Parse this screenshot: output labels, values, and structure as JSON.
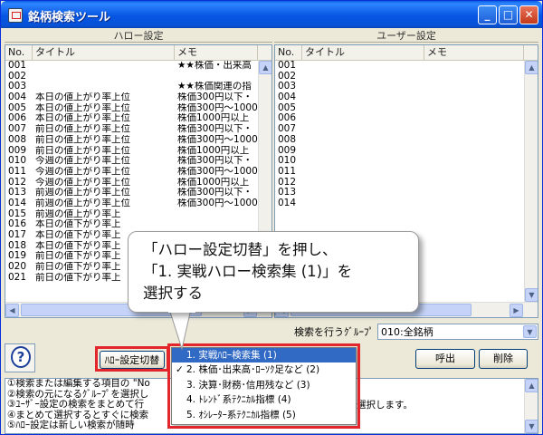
{
  "window": {
    "title": "銘柄検索ツール"
  },
  "left_panel": {
    "heading": "ハロー設定",
    "columns": [
      "No.",
      "タイトル",
      "メモ"
    ],
    "rows": [
      {
        "no": "001",
        "title": "",
        "memo": "★★株価・出来高"
      },
      {
        "no": "002",
        "title": "",
        "memo": ""
      },
      {
        "no": "003",
        "title": "",
        "memo": "★★株価関連の指"
      },
      {
        "no": "004",
        "title": "本日の値上がり率上位",
        "memo": "株価300円以下・"
      },
      {
        "no": "005",
        "title": "本日の値上がり率上位",
        "memo": "株価300円～1000"
      },
      {
        "no": "006",
        "title": "本日の値上がり率上位",
        "memo": "株価1000円以上"
      },
      {
        "no": "007",
        "title": "前日の値上がり率上位",
        "memo": "株価300円以下・"
      },
      {
        "no": "008",
        "title": "前日の値上がり率上位",
        "memo": "株価300円～1000"
      },
      {
        "no": "009",
        "title": "前日の値上がり率上位",
        "memo": "株価1000円以上"
      },
      {
        "no": "010",
        "title": "今週の値上がり率上位",
        "memo": "株価300円以下・"
      },
      {
        "no": "011",
        "title": "今週の値上がり率上位",
        "memo": "株価300円～1000"
      },
      {
        "no": "012",
        "title": "今週の値上がり率上位",
        "memo": "株価1000円以上"
      },
      {
        "no": "013",
        "title": "前週の値上がり率上位",
        "memo": "株価300円以下・"
      },
      {
        "no": "014",
        "title": "前週の値上がり率上位",
        "memo": "株価300円～1000"
      },
      {
        "no": "015",
        "title": "前週の値上がり率上",
        "memo": ""
      },
      {
        "no": "016",
        "title": "本日の値下がり率上",
        "memo": ""
      },
      {
        "no": "017",
        "title": "本日の値下がり率上",
        "memo": ""
      },
      {
        "no": "018",
        "title": "本日の値下がり率上",
        "memo": ""
      },
      {
        "no": "019",
        "title": "前日の値下がり率上",
        "memo": ""
      },
      {
        "no": "020",
        "title": "前日の値下がり率上",
        "memo": ""
      },
      {
        "no": "021",
        "title": "前日の値下がり率上",
        "memo": ""
      }
    ]
  },
  "right_panel": {
    "heading": "ユーザー設定",
    "columns": [
      "No.",
      "タイトル",
      "メモ"
    ],
    "rows": [
      "001",
      "002",
      "003",
      "004",
      "005",
      "006",
      "007",
      "008",
      "009",
      "010",
      "011",
      "012",
      "013",
      "014"
    ]
  },
  "group_select": {
    "label": "検索を行うｸﾞﾙｰﾌﾟ",
    "value": "010:全銘柄"
  },
  "buttons": {
    "switch": "ﾊﾛｰ設定切替",
    "call": "呼出",
    "delete": "削除",
    "help": "?"
  },
  "menu": {
    "items": [
      {
        "label": "1. 実戦ﾊﾛｰ検索集 (1)",
        "checked": false,
        "selected": true
      },
      {
        "label": "2. 株価･出来高･ﾛｰｿｸ足など (2)",
        "checked": true,
        "selected": false
      },
      {
        "label": "3. 決算･財務･信用残など (3)",
        "checked": false,
        "selected": false
      },
      {
        "label": "4. ﾄﾚﾝﾄﾞ系ﾃｸﾆｶﾙ指標 (4)",
        "checked": false,
        "selected": false
      },
      {
        "label": "5. ｵｼﾚｰﾀｰ系ﾃｸﾆｶﾙ指標 (5)",
        "checked": false,
        "selected": false
      }
    ]
  },
  "callout": {
    "lines": [
      "「ハロー設定切替」を押し、",
      "「1. 実戦ハロー検索集 (1)」を",
      "選択する"
    ]
  },
  "info": {
    "lines": [
      "①検索または編集する項目の \"No",
      "②検索の元になるｸﾞﾙｰﾌﾟを選択し",
      "③ﾕｰｻﾞｰ設定の検索をまとめて行",
      "④まとめて選択するとすぐに検索",
      "⑤ﾊﾛｰ設定は新しい検索が随時"
    ],
    "tail_text": "選択します。"
  },
  "colors": {
    "highlight": "#e3262b",
    "selection": "#316ac5",
    "title_bar": "#0756e3"
  }
}
